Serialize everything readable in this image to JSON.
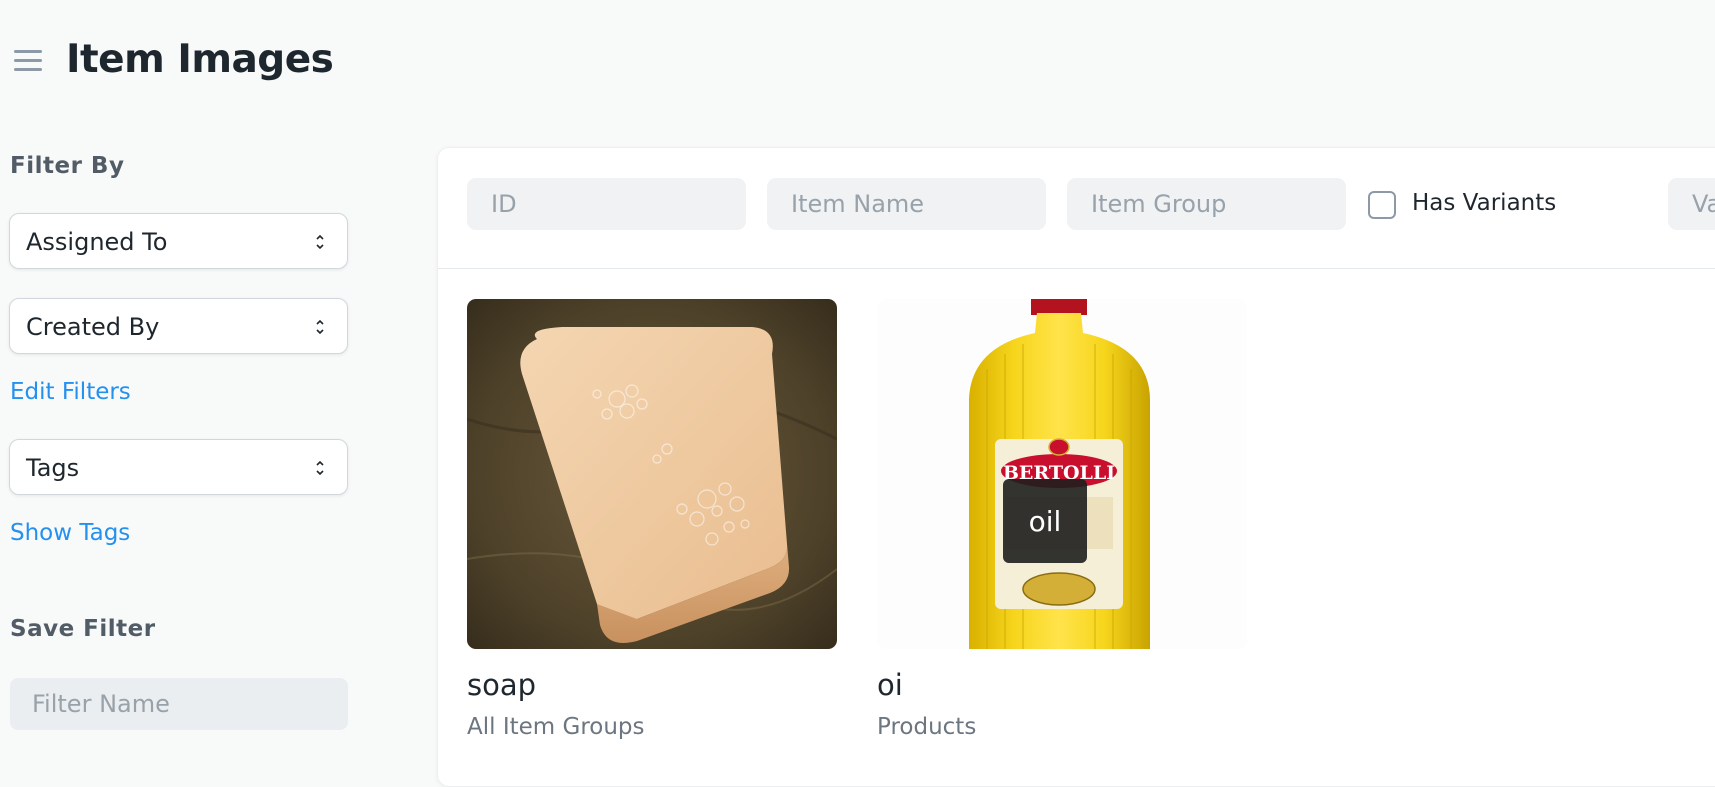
{
  "page": {
    "title": "Item Images"
  },
  "sidebar": {
    "filter_heading": "Filter By",
    "assigned_to": "Assigned To",
    "created_by": "Created By",
    "edit_filters": "Edit Filters",
    "tags": "Tags",
    "show_tags": "Show Tags",
    "save_filter_heading": "Save Filter",
    "filter_name_placeholder": "Filter Name"
  },
  "filters": {
    "id_placeholder": "ID",
    "item_name_placeholder": "Item Name",
    "item_group_placeholder": "Item Group",
    "has_variants_label": "Has Variants",
    "has_variants_checked": false,
    "truncated_placeholder": "Va"
  },
  "items": [
    {
      "name": "soap",
      "group": "All Item Groups",
      "image": "soap-photo"
    },
    {
      "name": "oi",
      "group": "Products",
      "image": "olive-oil-bottle-photo",
      "alt_text": "oil",
      "brand_text": "BERTOLLI"
    }
  ],
  "colors": {
    "background": "#f8f9f9",
    "link": "#2490ef",
    "oil_yellow": "#f3cf0c",
    "brand_red": "#c8102e"
  }
}
